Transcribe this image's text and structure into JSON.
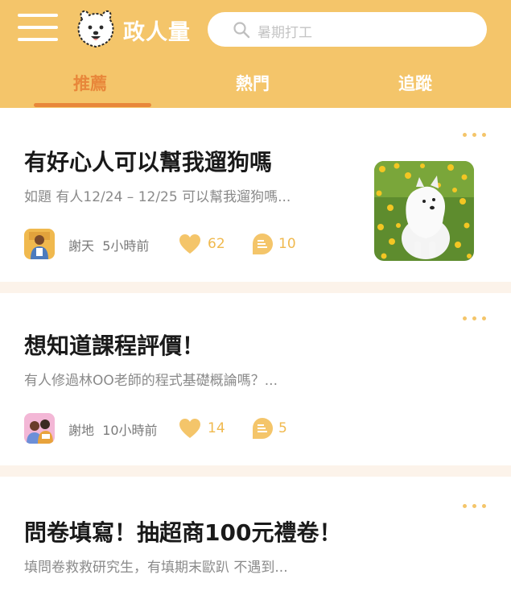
{
  "app": {
    "name": "政人量"
  },
  "search": {
    "placeholder": "暑期打工"
  },
  "tabs": [
    {
      "label": "推薦",
      "active": true
    },
    {
      "label": "熱門",
      "active": false
    },
    {
      "label": "追蹤",
      "active": false
    }
  ],
  "posts": [
    {
      "title": "有好心人可以幫我遛狗嗎",
      "excerpt": "如題 有人12/24 – 12/25 可以幫我遛狗嗎...",
      "author": "謝天",
      "time": "5小時前",
      "likes": "62",
      "comments": "10",
      "has_image": true,
      "image_icon": "samoyed-photo"
    },
    {
      "title": "想知道課程評價！",
      "excerpt": "有人修過林OO老師的程式基礎概論嗎？...",
      "author": "謝地",
      "time": "10小時前",
      "likes": "14",
      "comments": "5",
      "has_image": false
    },
    {
      "title": "問卷填寫！抽超商100元禮卷！",
      "excerpt": "填問卷救救研究生，有填期末歐趴 不遇到..."
    }
  ],
  "colors": {
    "brand": "#F4C56A",
    "active_tab": "#E8873A",
    "divider": "#FCF3EA",
    "count_text": "#F0B94E"
  },
  "icons": [
    "menu-icon",
    "samoyed-logo",
    "search-icon",
    "more-icon",
    "heart-icon",
    "comment-icon"
  ]
}
